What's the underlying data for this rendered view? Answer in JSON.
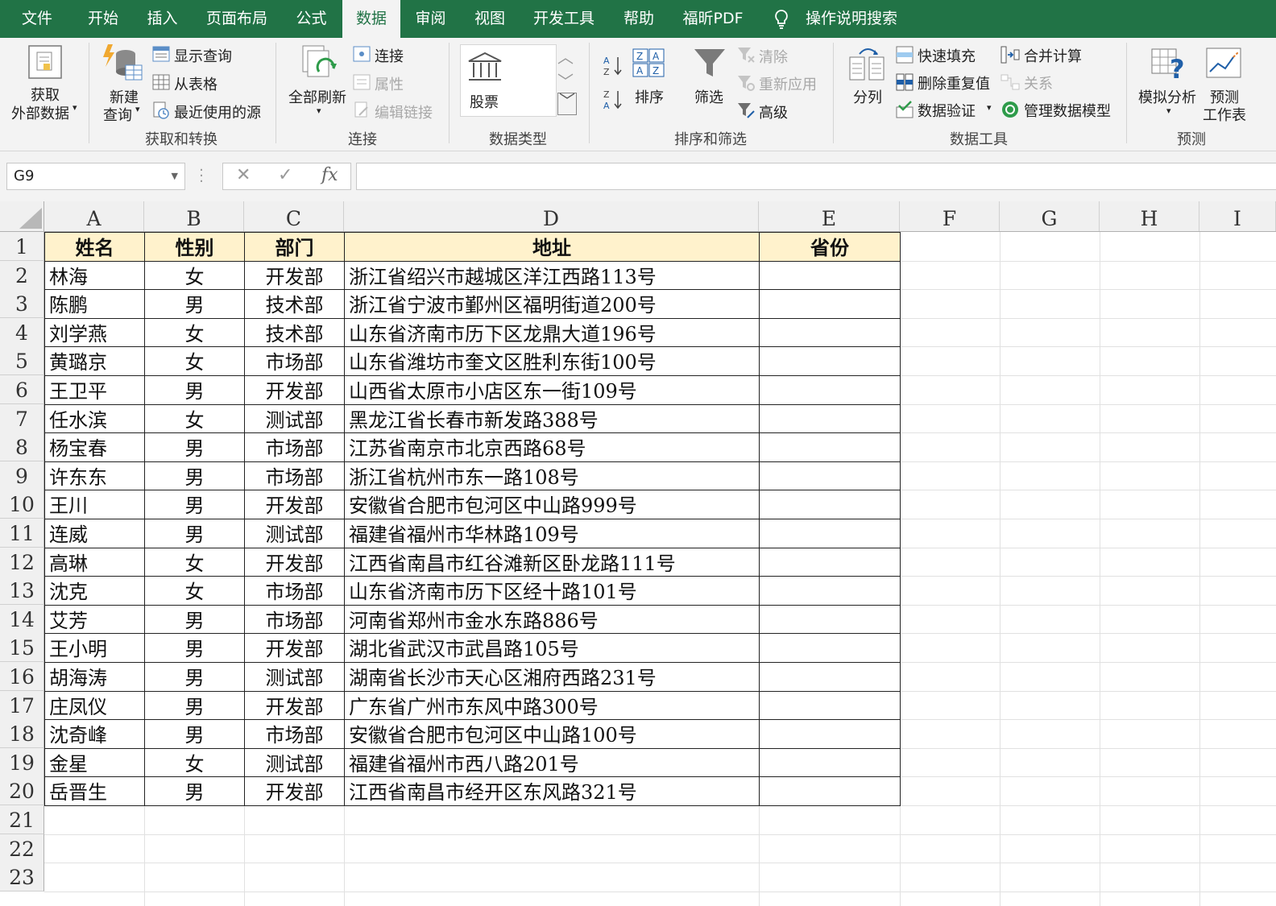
{
  "tabs": [
    "文件",
    "开始",
    "插入",
    "页面布局",
    "公式",
    "数据",
    "审阅",
    "视图",
    "开发工具",
    "帮助",
    "福昕PDF"
  ],
  "active_tab": "数据",
  "tell_me": "操作说明搜索",
  "ribbon": {
    "get_external": {
      "line1": "获取",
      "line2": "外部数据"
    },
    "new_query": {
      "line1": "新建",
      "line2": "查询"
    },
    "show_query": "显示查询",
    "from_table": "从表格",
    "recent_sources": "最近使用的源",
    "group_get_transform": "获取和转换",
    "refresh_all": "全部刷新",
    "connections": "连接",
    "properties": "属性",
    "edit_links": "编辑链接",
    "group_connections": "连接",
    "stocks": "股票",
    "group_data_types": "数据类型",
    "sort": "排序",
    "filter": "筛选",
    "clear": "清除",
    "reapply": "重新应用",
    "advanced": "高级",
    "group_sort_filter": "排序和筛选",
    "text_to_columns": "分列",
    "flash_fill": "快速填充",
    "remove_duplicates": "删除重复值",
    "data_validation": "数据验证",
    "consolidate": "合并计算",
    "relationships": "关系",
    "manage_data_model": "管理数据模型",
    "group_data_tools": "数据工具",
    "what_if": "模拟分析",
    "forecast": {
      "line1": "预测",
      "line2": "工作表"
    },
    "group_forecast": "预测"
  },
  "formula_bar": {
    "name_box": "G9",
    "cancel": "✕",
    "enter": "✓",
    "fx": "fx",
    "formula": ""
  },
  "columns": [
    "A",
    "B",
    "C",
    "D",
    "E",
    "F",
    "G",
    "H",
    "I"
  ],
  "row_numbers": [
    "1",
    "2",
    "3",
    "4",
    "5",
    "6",
    "7",
    "8",
    "9",
    "10",
    "11",
    "12",
    "13",
    "14",
    "15",
    "16",
    "17",
    "18",
    "19",
    "20",
    "21",
    "22",
    "23"
  ],
  "table": {
    "headers": [
      "姓名",
      "性别",
      "部门",
      "地址",
      "省份"
    ],
    "rows": [
      [
        "林海",
        "女",
        "开发部",
        "浙江省绍兴市越城区洋江西路113号",
        ""
      ],
      [
        "陈鹏",
        "男",
        "技术部",
        "浙江省宁波市鄞州区福明街道200号",
        ""
      ],
      [
        "刘学燕",
        "女",
        "技术部",
        "山东省济南市历下区龙鼎大道196号",
        ""
      ],
      [
        "黄璐京",
        "女",
        "市场部",
        "山东省潍坊市奎文区胜利东街100号",
        ""
      ],
      [
        "王卫平",
        "男",
        "开发部",
        "山西省太原市小店区东一街109号",
        ""
      ],
      [
        "任水滨",
        "女",
        "测试部",
        "黑龙江省长春市新发路388号",
        ""
      ],
      [
        "杨宝春",
        "男",
        "市场部",
        "江苏省南京市北京西路68号",
        ""
      ],
      [
        "许东东",
        "男",
        "市场部",
        "浙江省杭州市东一路108号",
        ""
      ],
      [
        "王川",
        "男",
        "开发部",
        "安徽省合肥市包河区中山路999号",
        ""
      ],
      [
        "连威",
        "男",
        "测试部",
        "福建省福州市华林路109号",
        ""
      ],
      [
        "高琳",
        "女",
        "开发部",
        "江西省南昌市红谷滩新区卧龙路111号",
        ""
      ],
      [
        "沈克",
        "女",
        "市场部",
        "山东省济南市历下区经十路101号",
        ""
      ],
      [
        "艾芳",
        "男",
        "市场部",
        "河南省郑州市金水东路886号",
        ""
      ],
      [
        "王小明",
        "男",
        "开发部",
        "湖北省武汉市武昌路105号",
        ""
      ],
      [
        "胡海涛",
        "男",
        "测试部",
        "湖南省长沙市天心区湘府西路231号",
        ""
      ],
      [
        "庄凤仪",
        "男",
        "开发部",
        "广东省广州市东风中路300号",
        ""
      ],
      [
        "沈奇峰",
        "男",
        "市场部",
        "安徽省合肥市包河区中山路100号",
        ""
      ],
      [
        "金星",
        "女",
        "测试部",
        "福建省福州市西八路201号",
        ""
      ],
      [
        "岳晋生",
        "男",
        "开发部",
        "江西省南昌市经开区东风路321号",
        ""
      ]
    ]
  },
  "colors": {
    "accent": "#217346",
    "header_fill": "#fff2cc",
    "ribbon_bg": "#f3f3f3"
  }
}
